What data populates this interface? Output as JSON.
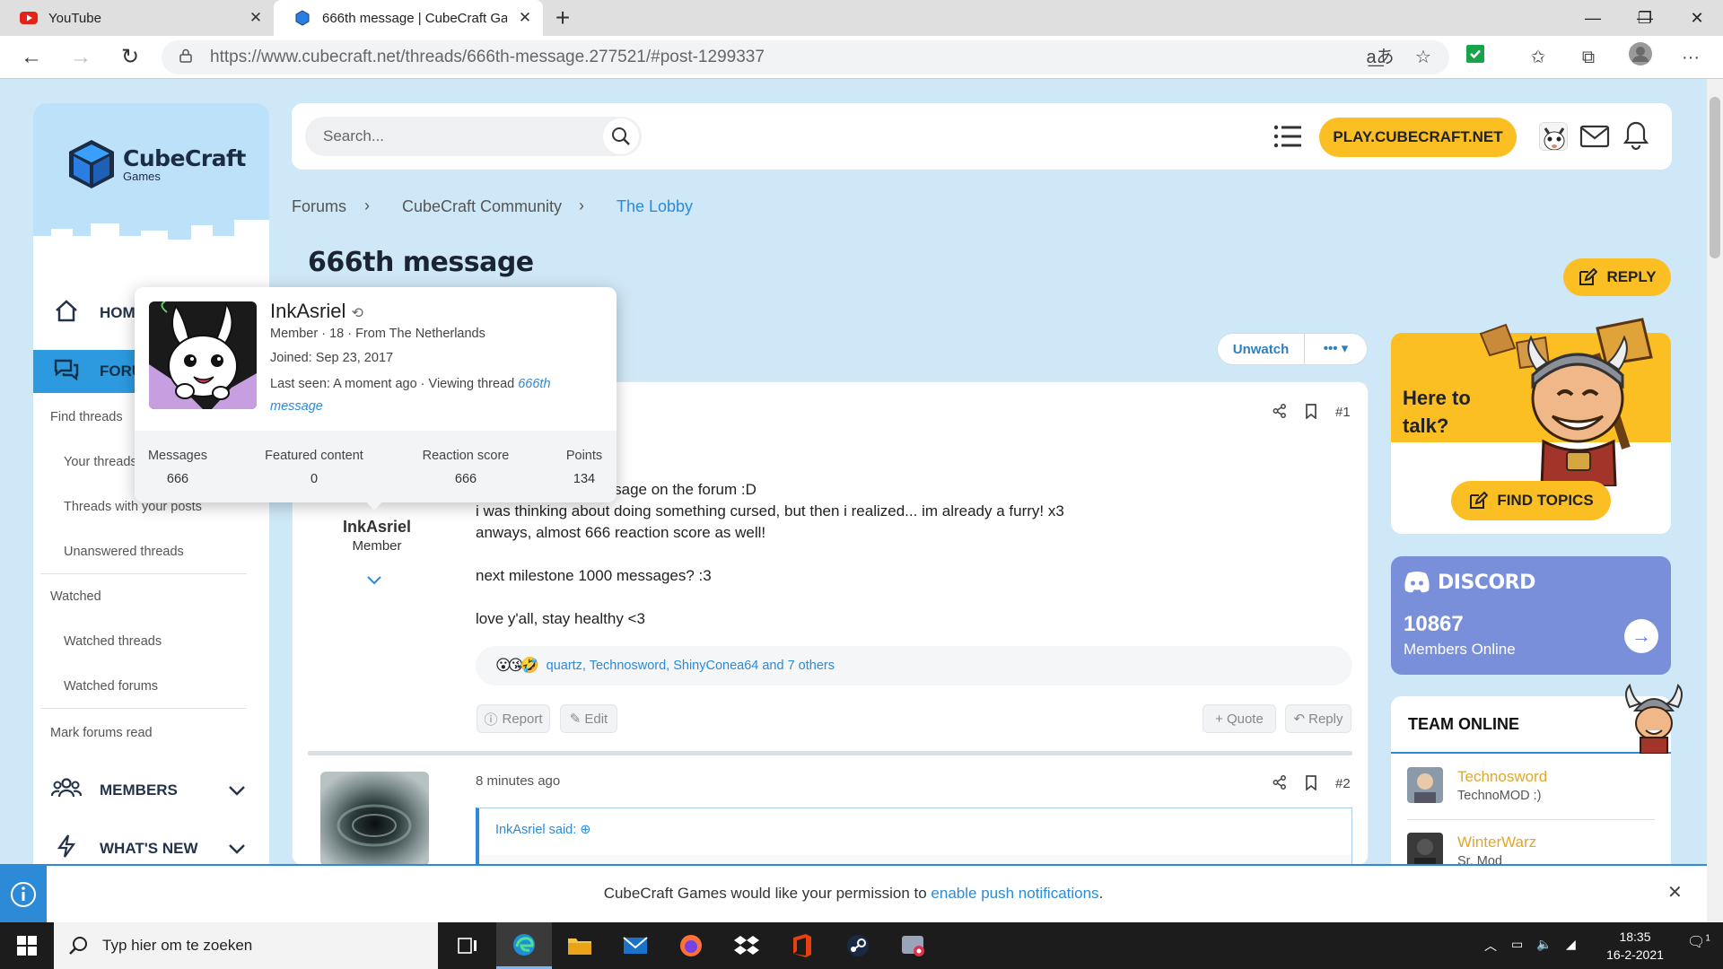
{
  "browser": {
    "tabs": [
      {
        "title": "YouTube",
        "icon": "youtube-icon"
      },
      {
        "title": "666th message | CubeCraft Games",
        "icon": "cubecraft-icon"
      }
    ],
    "url_domain": "https://www.cubecraft.net",
    "url_path": "/threads/666th-message.277521/#post-1299337"
  },
  "sidebar": {
    "logo_main": "CubeCraft",
    "logo_sub": "Games",
    "nav_home": "HOME",
    "nav_forums": "FORUMS",
    "links": [
      "Find threads",
      "Your threads",
      "Threads with your posts",
      "Unanswered threads",
      "Watched",
      "Watched threads",
      "Watched forums",
      "Mark forums read"
    ],
    "nav_members": "MEMBERS",
    "nav_whatsnew": "WHAT'S NEW"
  },
  "header": {
    "search_placeholder": "Search...",
    "play_button": "PLAY.CUBECRAFT.NET"
  },
  "breadcrumb": [
    "Forums",
    "CubeCraft Community",
    "The Lobby"
  ],
  "thread": {
    "title": "666th message",
    "reply_button": "REPLY",
    "unwatch_button": "Unwatch",
    "more_button": "•••"
  },
  "post1": {
    "number": "#1",
    "author": "InkAsriel",
    "role": "Member",
    "lines": [
      "message on the forum :D",
      "i was thinking about doing something cursed, but then i realized... im already a furry! x3",
      "anways, almost 666 reaction score as well!",
      "next milestone 1000 messages? :3",
      "love y'all, stay healthy <3"
    ],
    "reactions_emoji": "😮😘🤣",
    "reactions_text": "quartz, Technosword, ShinyConea64 and 7 others",
    "buttons": {
      "report": "Report",
      "edit": "Edit",
      "quote": "Quote",
      "reply": "Reply"
    }
  },
  "post2": {
    "number": "#2",
    "time": "8 minutes ago",
    "quote_header": "InkAsriel said:"
  },
  "hovercard": {
    "name": "InkAsriel",
    "line1": "Member · 18 · From The Netherlands",
    "joined_label": "Joined:",
    "joined_value": "Sep 23, 2017",
    "lastseen_label": "Last seen:",
    "lastseen_value": "A moment ago · Viewing thread",
    "lastseen_link1": "666th",
    "lastseen_link2": "message",
    "stats": [
      {
        "label": "Messages",
        "value": "666"
      },
      {
        "label": "Featured content",
        "value": "0"
      },
      {
        "label": "Reaction score",
        "value": "666"
      },
      {
        "label": "Points",
        "value": "134"
      }
    ]
  },
  "right": {
    "talk_line1": "Here to",
    "talk_line2": "talk?",
    "find_topics": "FIND TOPICS",
    "discord_title": "DISCORD",
    "discord_count": "10867",
    "discord_label": "Members Online",
    "team_title": "TEAM ONLINE",
    "team": [
      {
        "name": "Technosword",
        "role": "TechnoMOD :)"
      },
      {
        "name": "WinterWarz",
        "role": "Sr. Mod"
      }
    ]
  },
  "notification": {
    "text_before": "CubeCraft Games would like your permission to",
    "link": "enable push notifications",
    "text_after": "."
  },
  "taskbar": {
    "search_placeholder": "Typ hier om te zoeken",
    "time": "18:35",
    "date": "16-2-2021",
    "notif_count": "1"
  },
  "colors": {
    "accent": "#2d8ad6",
    "yellow": "#fbbf24",
    "discord": "#7a8fd9"
  }
}
